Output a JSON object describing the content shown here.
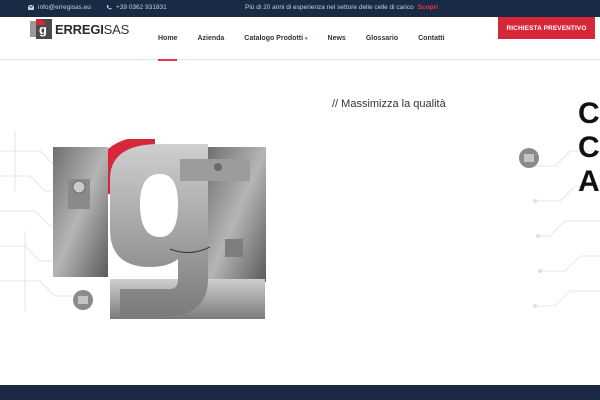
{
  "topbar": {
    "email": "info@erregisas.eu",
    "phone": "+39 0362 931831",
    "promo_text": "Più di 20 anni di esperienza nel settore delle celle di carico",
    "promo_link": "Scopri"
  },
  "header": {
    "logo_bold": "ERREGI",
    "logo_light": "SAS",
    "nav": [
      {
        "label": "Home"
      },
      {
        "label": "Azienda"
      },
      {
        "label": "Catalogo Prodotti"
      },
      {
        "label": "News"
      },
      {
        "label": "Glossario"
      },
      {
        "label": "Contatti"
      }
    ],
    "cta_label": "RICHIESTA PREVENTIVO"
  },
  "hero": {
    "tagline": "// Massimizza la qualità",
    "big_letters": [
      "C",
      "C",
      "A"
    ]
  },
  "colors": {
    "accent": "#d62839",
    "navy": "#1a2a44"
  }
}
